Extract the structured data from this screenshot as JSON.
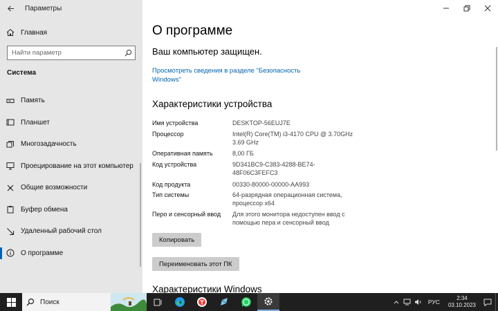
{
  "window": {
    "title": "Параметры"
  },
  "sidebar": {
    "home_label": "Главная",
    "search_placeholder": "Найти параметр",
    "section_heading": "Система",
    "items": [
      {
        "label": "Память",
        "icon": "storage-icon"
      },
      {
        "label": "Планшет",
        "icon": "tablet-icon"
      },
      {
        "label": "Многозадачность",
        "icon": "multitasking-icon"
      },
      {
        "label": "Проецирование на этот компьютер",
        "icon": "projecting-icon"
      },
      {
        "label": "Общие возможности",
        "icon": "shared-experiences-icon"
      },
      {
        "label": "Буфер обмена",
        "icon": "clipboard-icon"
      },
      {
        "label": "Удаленный рабочий стол",
        "icon": "remote-desktop-icon"
      },
      {
        "label": "О программе",
        "icon": "info-icon",
        "active": true
      }
    ]
  },
  "main": {
    "title": "О программе",
    "protected": "Ваш компьютер защищен.",
    "security_link": "Просмотреть сведения в разделе \"Безопасность Windows\"",
    "device_specs_heading": "Характеристики устройства",
    "specs": [
      {
        "label": "Имя устройства",
        "value": "DESKTOP-56EUJ7E"
      },
      {
        "label": "Процессор",
        "value": "Intel(R) Core(TM) i3-4170 CPU @ 3.70GHz 3.69 GHz"
      },
      {
        "label": "Оперативная память",
        "value": "8,00 ГБ"
      },
      {
        "label": "Код устройства",
        "value": "9D341BC9-C383-4288-BE74-48F06C3FEFC3"
      },
      {
        "label": "Код продукта",
        "value": "00330-80000-00000-AA993"
      },
      {
        "label": "Тип системы",
        "value": "64-разрядная операционная система, процессор x64"
      },
      {
        "label": "Перо и сенсорный ввод",
        "value": "Для этого монитора недоступен ввод с помощью пера и сенсорный ввод"
      }
    ],
    "copy_button": "Копировать",
    "rename_button": "Переименовать этот ПК",
    "windows_specs_heading": "Характеристики Windows"
  },
  "taskbar": {
    "search_label": "Поиск",
    "language": "РУС",
    "time": "2:34",
    "date": "03.10.2023"
  },
  "colors": {
    "accent": "#0063b1",
    "sidebar_bg": "#e6e6e6",
    "taskbar_bg": "#1f1f1f"
  }
}
